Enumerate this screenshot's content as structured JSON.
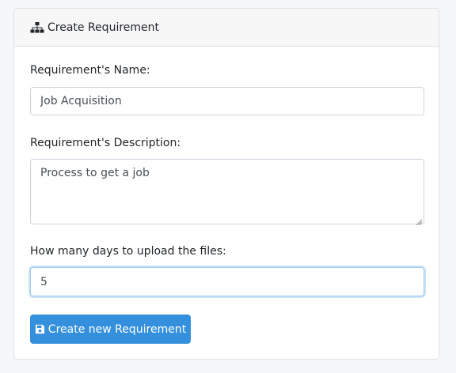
{
  "card": {
    "title": "Create Requirement",
    "title_icon": "sitemap-icon"
  },
  "form": {
    "name_label": "Requirement's Name:",
    "name_value": "Job Acquisition",
    "description_label": "Requirement's Description:",
    "description_value": "Process to get a job",
    "days_label": "How many days to upload the files:",
    "days_value": "5",
    "submit_label": "Create new Requirement",
    "submit_icon": "save-icon"
  },
  "colors": {
    "primary": "#3490dc",
    "focus_border": "#a1cbef"
  }
}
